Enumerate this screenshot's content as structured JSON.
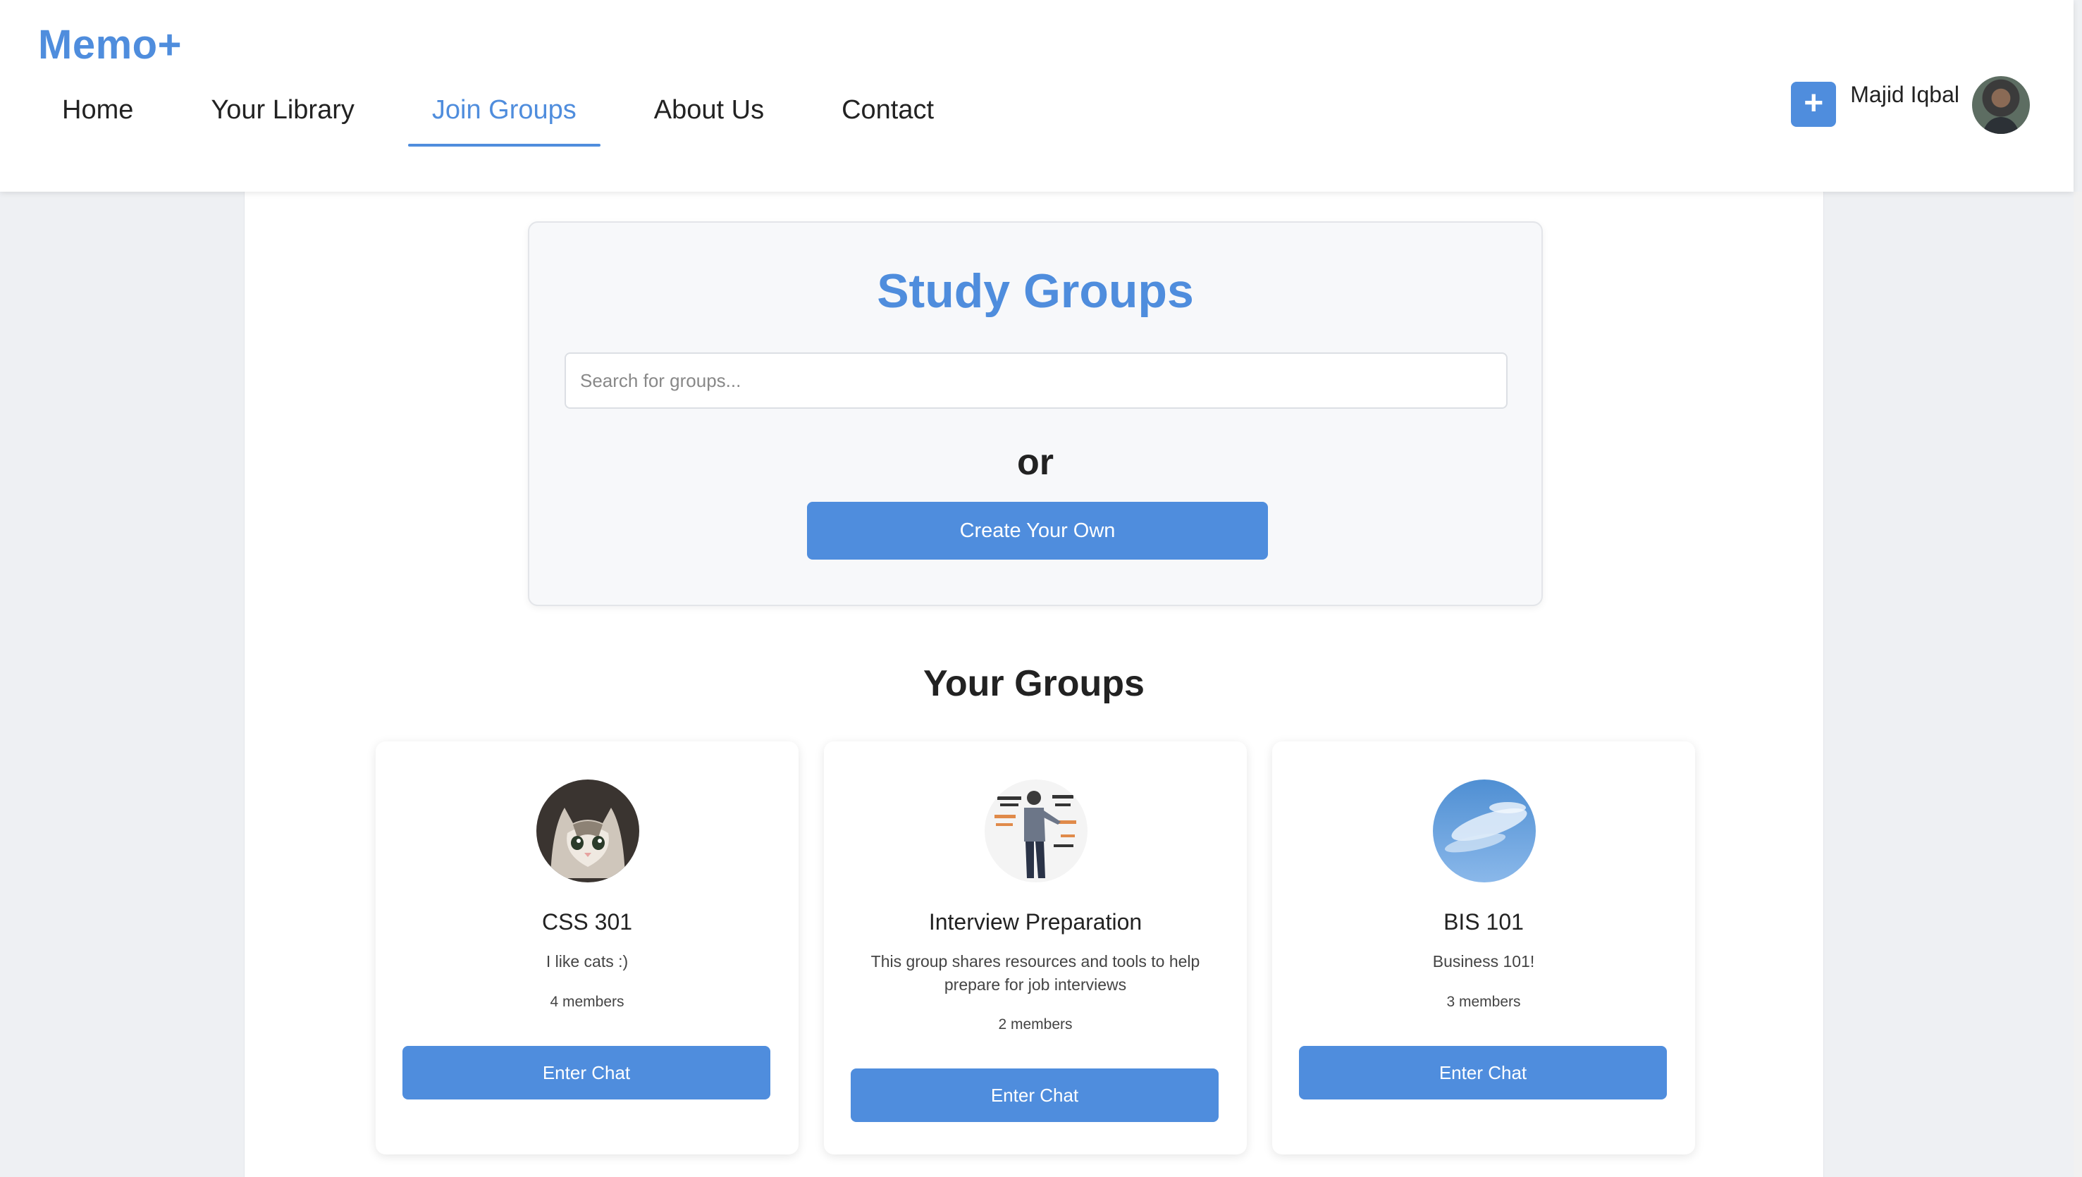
{
  "header": {
    "brand": "Memo+",
    "nav": [
      {
        "label": "Home",
        "active": false
      },
      {
        "label": "Your Library",
        "active": false
      },
      {
        "label": "Join Groups",
        "active": true
      },
      {
        "label": "About Us",
        "active": false
      },
      {
        "label": "Contact",
        "active": false
      }
    ],
    "add_button_symbol": "+",
    "user_name": "Majid Iqbal"
  },
  "study_groups": {
    "title": "Study Groups",
    "search_placeholder": "Search for groups...",
    "or_text": "or",
    "create_button": "Create Your Own"
  },
  "your_groups": {
    "title": "Your Groups",
    "groups": [
      {
        "name": "CSS 301",
        "description": "I like cats :)",
        "members": "4 members",
        "button": "Enter Chat",
        "image": "cat-icon"
      },
      {
        "name": "Interview Preparation",
        "description": "This group shares resources and tools to help prepare for job interviews",
        "members": "2 members",
        "button": "Enter Chat",
        "image": "presenter-icon"
      },
      {
        "name": "BIS 101",
        "description": "Business 101!",
        "members": "3 members",
        "button": "Enter Chat",
        "image": "sky-icon"
      }
    ]
  },
  "colors": {
    "accent": "#4f8ddd",
    "background": "#eef0f3",
    "panel": "#ffffff"
  }
}
